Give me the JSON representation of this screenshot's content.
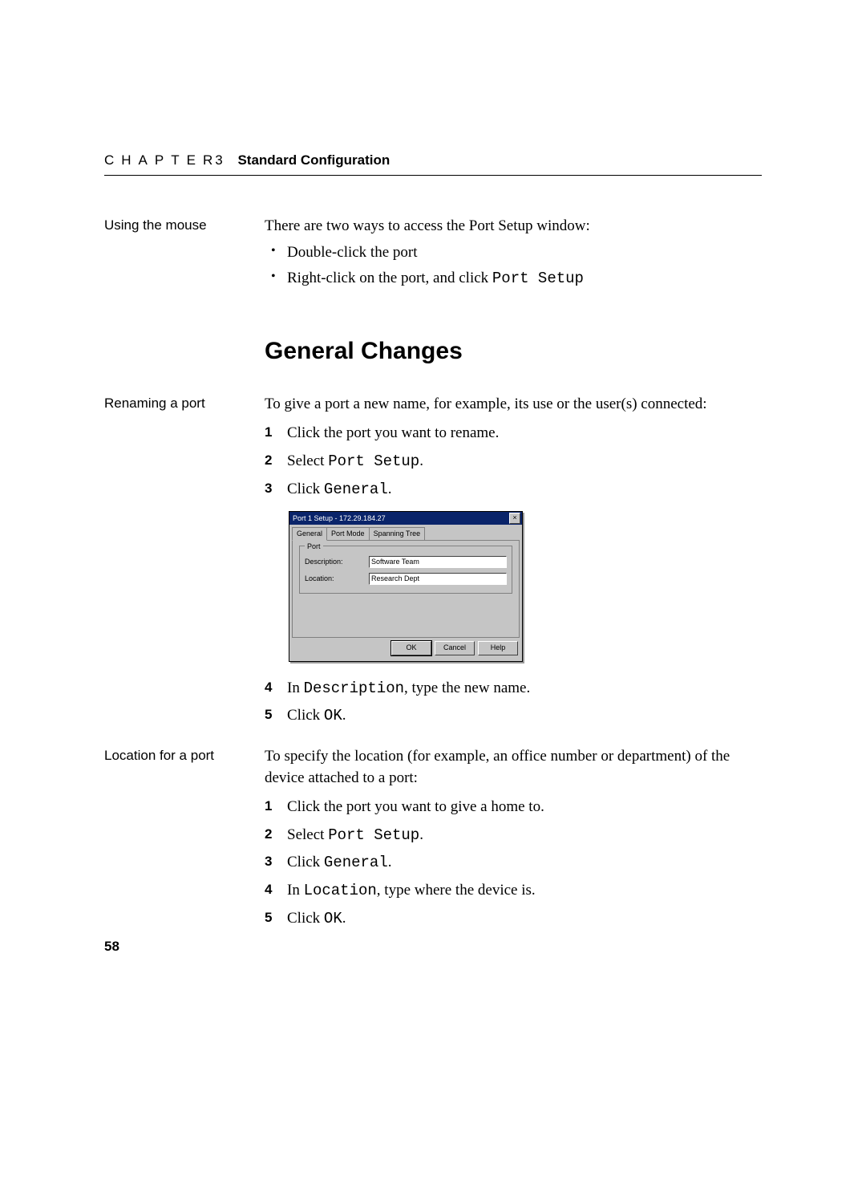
{
  "header": {
    "chapter_word": "CHAPTER",
    "chapter_num": "3",
    "title": "Standard Configuration"
  },
  "section1": {
    "margin": "Using the mouse",
    "intro": "There are two ways to access the Port Setup window:",
    "bullets": {
      "b1": "Double-click the port",
      "b2_pre": "Right-click on the port, and click ",
      "b2_code": "Port Setup"
    }
  },
  "heading": "General Changes",
  "section2": {
    "margin": "Renaming a port",
    "intro": "To give a port a new name, for example, its use or the user(s) connected:",
    "s1": "Click the port you want to rename.",
    "s2_pre": "Select ",
    "s2_code": "Port Setup",
    "s3_pre": "Click ",
    "s3_code": "General",
    "s4_pre": "In ",
    "s4_code": "Description",
    "s4_post": ", type the new name.",
    "s5_pre": "Click ",
    "s5_code": "OK"
  },
  "section3": {
    "margin": "Location for a port",
    "intro": "To specify the location (for example, an office number or department) of the device attached to a port:",
    "s1": "Click the port you want to give a home to.",
    "s2_pre": "Select ",
    "s2_code": "Port Setup",
    "s3_pre": "Click ",
    "s3_code": "General",
    "s4_pre": "In ",
    "s4_code": "Location",
    "s4_post": ", type where the device is.",
    "s5_pre": "Click ",
    "s5_code": "OK"
  },
  "dialog": {
    "title": "Port 1 Setup - 172.29.184.27",
    "tabs": {
      "t1": "General",
      "t2": "Port Mode",
      "t3": "Spanning Tree"
    },
    "group": "Port",
    "label1": "Description:",
    "value1": "Software Team",
    "label2": "Location:",
    "value2": "Research Dept",
    "ok": "OK",
    "cancel": "Cancel",
    "help": "Help"
  },
  "page_number": "58"
}
